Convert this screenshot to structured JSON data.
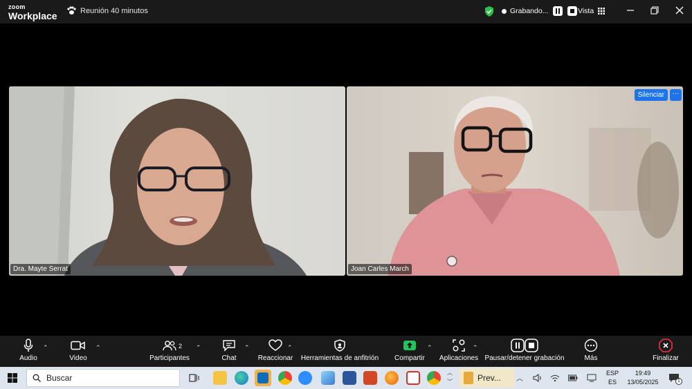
{
  "titlebar": {
    "logo_top": "zoom",
    "logo_bottom": "Workplace",
    "meeting_label": "Reunión 40 minutos",
    "recording_label": "Grabando...",
    "view_label": "Vista"
  },
  "participants": [
    {
      "name": "Dra. Mayte Serrat"
    },
    {
      "name": "Joan Carles March",
      "mute_label": "Silenciar",
      "more_label": "···"
    }
  ],
  "toolbar": {
    "audio": "Audio",
    "video": "Video",
    "participants": "Participantes",
    "participants_count": "2",
    "chat": "Chat",
    "react": "Reaccionar",
    "host_tools": "Herramientas de anfitrión",
    "share": "Compartir",
    "apps": "Aplicaciones",
    "pause_recording": "Pausar/detener grabación",
    "more": "Más",
    "end": "Finalizar"
  },
  "taskbar": {
    "search_placeholder": "Buscar",
    "active_app_label": "Prev...",
    "lang_top": "ESP",
    "lang_bottom": "ES",
    "time": "19:49",
    "date": "13/05/2025",
    "notification_count": "1"
  },
  "colors": {
    "accent": "#1e73e8",
    "share_green": "#22c55e",
    "end_red": "#e02d3c",
    "shield_green": "#2fbf4a"
  }
}
